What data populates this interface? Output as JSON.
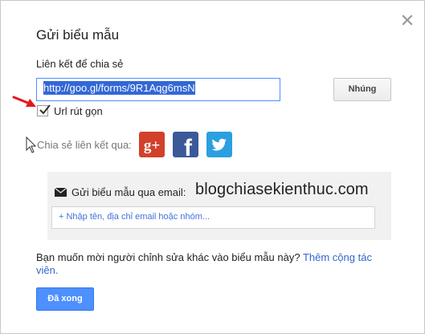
{
  "dialog": {
    "title": "Gửi biểu mẫu",
    "close_icon": "close-icon"
  },
  "share_link": {
    "label": "Liên kết để chia sẻ",
    "url": "http://goo.gl/forms/9R1Aqg6msN",
    "embed_label": "Nhúng"
  },
  "short_url": {
    "checked": true,
    "label": "Url rút gọn"
  },
  "share_via": {
    "label": "Chia sẻ liên kết qua:",
    "networks": [
      {
        "name": "Google+",
        "glyph": "g+",
        "icon": "google-plus-icon",
        "color": "#d1412b"
      },
      {
        "name": "Facebook",
        "glyph": "f",
        "icon": "facebook-icon",
        "color": "#3b5998"
      },
      {
        "name": "Twitter",
        "icon": "twitter-icon",
        "color": "#2aa0e0"
      }
    ]
  },
  "email": {
    "label": "Gửi biểu mẫu qua email:",
    "placeholder": "+ Nhập tên, địa chỉ email hoặc nhóm..."
  },
  "watermark": "blogchiasekienthuc.com",
  "invite": {
    "text": "Bạn muốn mời người chỉnh sửa khác vào biểu mẫu này?",
    "link": "Thêm cộng tác viên."
  },
  "footer": {
    "done_label": "Đã xong"
  },
  "colors": {
    "primary_button": "#4d90fe",
    "link": "#3366cc",
    "selection": "#3367d6",
    "annotation_arrow": "#e0191e"
  }
}
